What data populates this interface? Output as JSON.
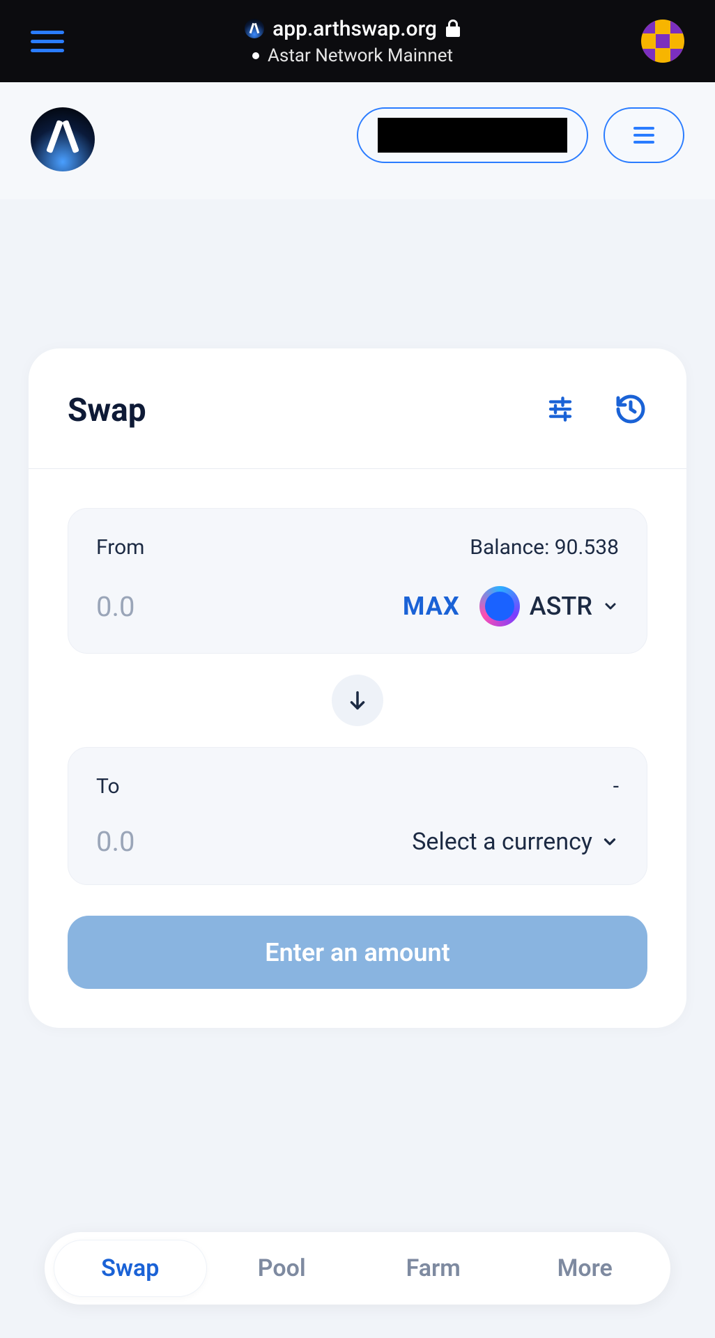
{
  "browser": {
    "url": "app.arthswap.org",
    "network": "Astar Network Mainnet"
  },
  "swap": {
    "title": "Swap",
    "from": {
      "label": "From",
      "balance_label": "Balance: 90.538",
      "placeholder": "0.0",
      "max_label": "MAX",
      "token": "ASTR"
    },
    "to": {
      "label": "To",
      "balance_label": "-",
      "placeholder": "0.0",
      "select_label": "Select a currency"
    },
    "action_label": "Enter an amount"
  },
  "tabs": {
    "swap": "Swap",
    "pool": "Pool",
    "farm": "Farm",
    "more": "More"
  }
}
